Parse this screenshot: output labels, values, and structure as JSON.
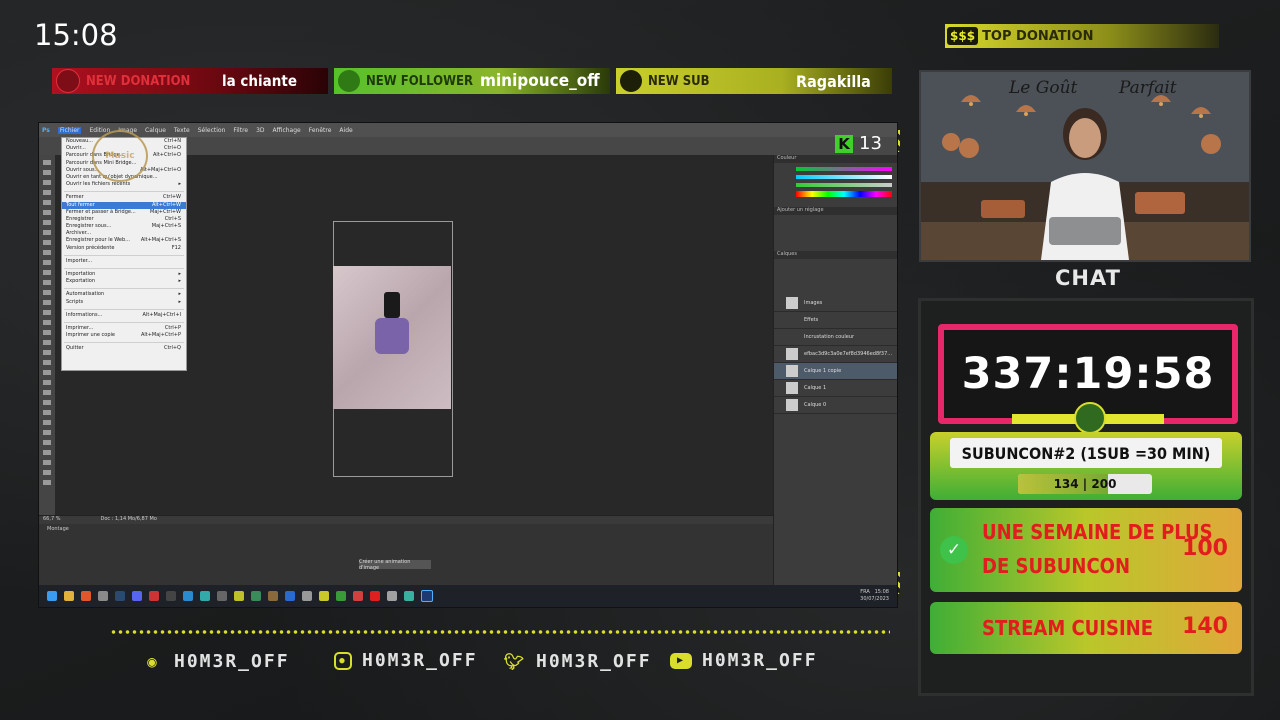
{
  "clock": "15:08",
  "alerts": {
    "donation": {
      "label": "NEW DONATION",
      "value": "la chiante"
    },
    "follower": {
      "label": "NEW FOLLOWER",
      "value": "minipouce_off"
    },
    "sub": {
      "label": "NEW SUB",
      "value": "Ragakilla"
    }
  },
  "top_donation": {
    "badge": "$$$",
    "label": "TOP DONATION"
  },
  "camera": {
    "title_left": "Le Goût",
    "title_right": "Parfait"
  },
  "chat_title": "CHAT",
  "timer": "337:19:58",
  "subuncon": {
    "label": "SUBUNCON#2 (1SUB =30 MIN)",
    "progress_text": "134 | 200",
    "progress_fraction": 0.67
  },
  "goals": [
    {
      "label_line1": "UNE SEMAINE DE PLUS",
      "label_line2": "DE SUBUNCON",
      "value": "100",
      "done": true
    },
    {
      "label_line1": "STREAM CUISINE",
      "label_line2": "",
      "value": "140",
      "done": false
    }
  ],
  "socials": [
    {
      "icon": "discord-icon",
      "handle": "H0M3R_OFF"
    },
    {
      "icon": "instagram-icon",
      "handle": "H0M3R_OFF"
    },
    {
      "icon": "twitter-icon",
      "handle": "H0M3R_OFF"
    },
    {
      "icon": "youtube-icon",
      "handle": "H0M3R_OFF"
    }
  ],
  "photoshop": {
    "menubar": [
      "Ps",
      "Fichier",
      "Edition",
      "Image",
      "Calque",
      "Texte",
      "Sélection",
      "Filtre",
      "3D",
      "Affichage",
      "Fenêtre",
      "Aide"
    ],
    "viewer_count": "13",
    "music_watermark": "Music",
    "file_menu": [
      {
        "label": "Nouveau...",
        "shortcut": "Ctrl+N"
      },
      {
        "label": "Ouvrir...",
        "shortcut": "Ctrl+O"
      },
      {
        "label": "Parcourir dans Bridge...",
        "shortcut": "Alt+Ctrl+O"
      },
      {
        "label": "Parcourir dans Mini Bridge...",
        "shortcut": ""
      },
      {
        "label": "Ouvrir sous...",
        "shortcut": "Alt+Maj+Ctrl+O"
      },
      {
        "label": "Ouvrir en tant qu'objet dynamique...",
        "shortcut": ""
      },
      {
        "label": "Ouvrir les fichiers récents",
        "shortcut": "▸"
      },
      {
        "sep": true
      },
      {
        "label": "Fermer",
        "shortcut": "Ctrl+W"
      },
      {
        "label": "Tout fermer",
        "shortcut": "Alt+Ctrl+W",
        "highlight": true
      },
      {
        "label": "Fermer et passer à Bridge...",
        "shortcut": "Maj+Ctrl+W"
      },
      {
        "label": "Enregistrer",
        "shortcut": "Ctrl+S"
      },
      {
        "label": "Enregistrer sous...",
        "shortcut": "Maj+Ctrl+S"
      },
      {
        "label": "Archiver...",
        "shortcut": ""
      },
      {
        "label": "Enregistrer pour le Web...",
        "shortcut": "Alt+Maj+Ctrl+S"
      },
      {
        "label": "Version précédente",
        "shortcut": "F12"
      },
      {
        "sep": true
      },
      {
        "label": "Importer...",
        "shortcut": ""
      },
      {
        "sep": true
      },
      {
        "label": "Importation",
        "shortcut": "▸"
      },
      {
        "label": "Exportation",
        "shortcut": "▸"
      },
      {
        "sep": true
      },
      {
        "label": "Automatisation",
        "shortcut": "▸"
      },
      {
        "label": "Scripts",
        "shortcut": "▸"
      },
      {
        "sep": true
      },
      {
        "label": "Informations...",
        "shortcut": "Alt+Maj+Ctrl+I"
      },
      {
        "sep": true
      },
      {
        "label": "Imprimer...",
        "shortcut": "Ctrl+P"
      },
      {
        "label": "Imprimer une copie",
        "shortcut": "Alt+Maj+Ctrl+P"
      },
      {
        "sep": true
      },
      {
        "label": "Quitter",
        "shortcut": "Ctrl+Q"
      }
    ],
    "layers_panel_title": "Calques",
    "adjust_panel_title": "Ajouter un réglage",
    "color_panel_title": "Couleur",
    "layers": [
      {
        "name": "Images",
        "selected": false
      },
      {
        "name": "Effets",
        "selected": false
      },
      {
        "name": "Incrustation couleur",
        "selected": false
      },
      {
        "name": "efbac3d9c3a0e7ef8d3946ed8f37...",
        "selected": false
      },
      {
        "name": "Calque 1 copie",
        "selected": true
      },
      {
        "name": "Calque 1",
        "selected": false
      },
      {
        "name": "Calque 0",
        "selected": false
      }
    ],
    "status_zoom": "66,7 %",
    "status_doc": "Doc : 1,14 Mo/6,87 Mo",
    "timeline_label": "Montage",
    "timeline_button": "Créer une animation d'image",
    "tray_lang": "FRA",
    "tray_time": "15:08",
    "tray_date": "30/07/2023"
  },
  "colors": {
    "accent_yellow": "#d9de2c",
    "timer_pink": "#e8266a",
    "goal_red": "#e21d1d"
  }
}
